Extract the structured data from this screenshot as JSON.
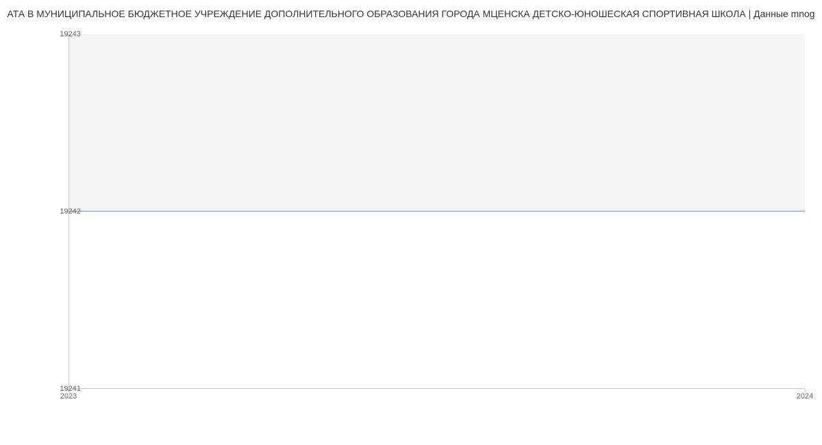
{
  "chart_data": {
    "type": "line",
    "title": "АТА В МУНИЦИПАЛЬНОЕ БЮДЖЕТНОЕ УЧРЕЖДЕНИЕ ДОПОЛНИТЕЛЬНОГО ОБРАЗОВАНИЯ ГОРОДА МЦЕНСКА ДЕТСКО-ЮНОШЕСКАЯ СПОРТИВНАЯ ШКОЛА | Данные mnog",
    "xlabel": "",
    "ylabel": "",
    "x": [
      "2023",
      "2024"
    ],
    "series": [
      {
        "name": "",
        "values": [
          19242,
          19242
        ],
        "color": "#6E94D0"
      }
    ],
    "y_ticks": [
      19241,
      19242,
      19243
    ],
    "ylim": [
      19241,
      19243
    ],
    "x_tick_labels": [
      "2023",
      "2024"
    ]
  }
}
